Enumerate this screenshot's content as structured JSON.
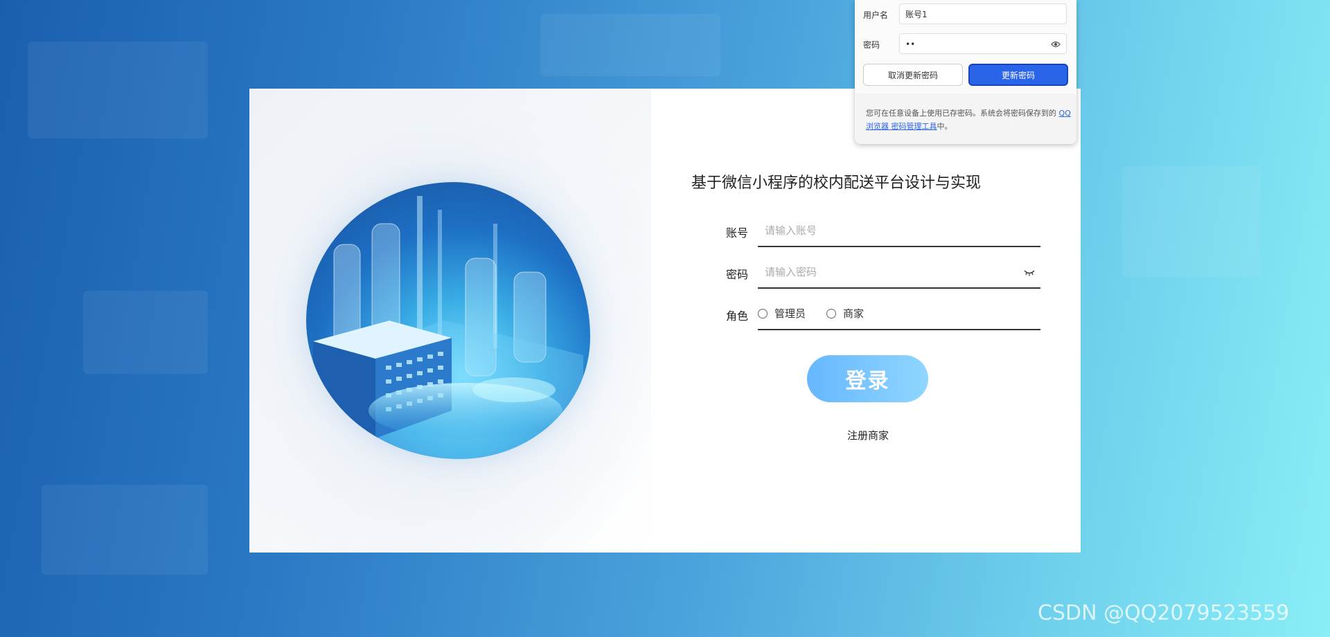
{
  "login": {
    "title": "基于微信小程序的校内配送平台设计与实现",
    "account_label": "账号",
    "account_placeholder": "请输入账号",
    "password_label": "密码",
    "password_placeholder": "请输入密码",
    "role_label": "角色",
    "roles": [
      "管理员",
      "商家"
    ],
    "login_button": "登录",
    "register_link": "注册商家"
  },
  "password_popup": {
    "username_label": "用户名",
    "username_value": "账号1",
    "password_label": "密码",
    "password_value": "••",
    "cancel_button": "取消更新密码",
    "update_button": "更新密码",
    "note_prefix": "您可在任意设备上使用已存密码。系统会将密码保存到的 ",
    "note_link": "QQ浏览器 密码管理工具",
    "note_suffix": "中。"
  },
  "watermark": "CSDN @QQ2079523559",
  "colors": {
    "accent": "#2a64e8",
    "login_button_start": "#66b7ff",
    "login_button_end": "#8fd6ff"
  }
}
